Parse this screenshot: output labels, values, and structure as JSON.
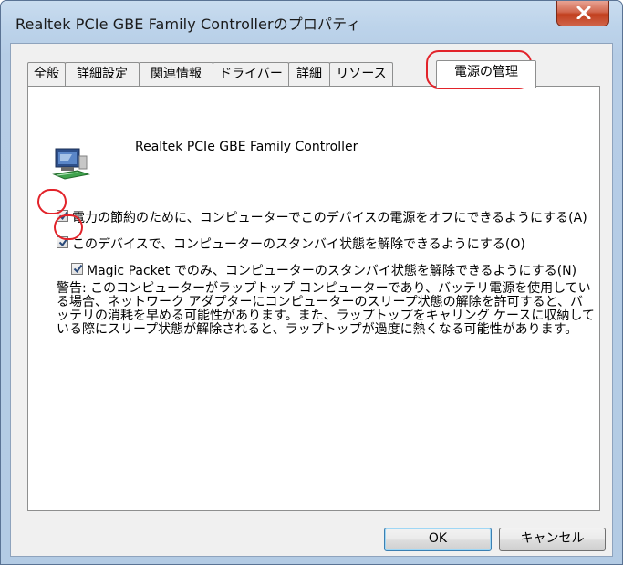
{
  "window": {
    "title": "Realtek PCIe GBE Family Controllerのプロパティ"
  },
  "tabs": [
    "全般",
    "詳細設定",
    "関連情報",
    "ドライバー",
    "詳細",
    "リソース",
    "電源の管理"
  ],
  "device": {
    "name": "Realtek PCIe GBE Family Controller"
  },
  "options": [
    {
      "label": "電力の節約のために、コンピューターでこのデバイスの電源をオフにできるようにする(A)",
      "checked": true
    },
    {
      "label": "このデバイスで、コンピューターのスタンバイ状態を解除できるようにする(O)",
      "checked": true
    },
    {
      "label": "Magic Packet でのみ、コンピューターのスタンバイ状態を解除できるようにする(N)",
      "checked": true
    }
  ],
  "warning": "警告: このコンピューターがラップトップ コンピューターであり、バッテリ電源を使用している場合、ネットワーク アダプターにコンピューターのスリープ状態の解除を許可すると、バッテリの消耗を早める可能性があります。また、ラップトップをキャリング ケースに収納している際にスリープ状態が解除されると、ラップトップが過度に熱くなる可能性があります。",
  "buttons": {
    "ok": "OK",
    "cancel": "キャンセル"
  },
  "colors": {
    "highlight_ring": "#e2232a",
    "title_bar": "#bcd3ea",
    "close_button": "#c2401f"
  },
  "icons": [
    "close-icon",
    "network-adapter-icon",
    "checkmark-icon"
  ]
}
